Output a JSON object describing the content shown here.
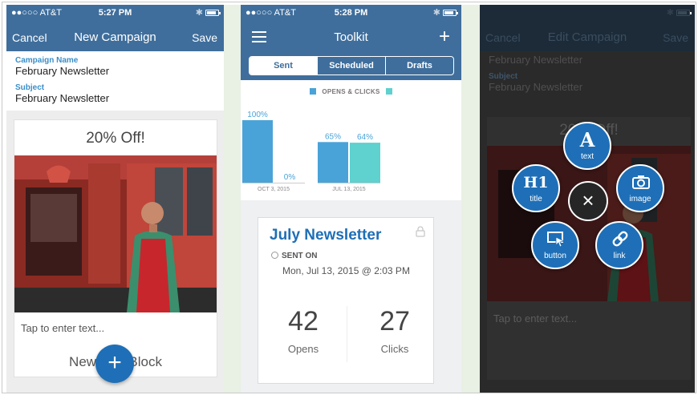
{
  "colors": {
    "nav_blue": "#3f6e9c",
    "accent_blue": "#1e6fb7",
    "field_label": "#3a8fc9",
    "bar_sent": "#4aa3d8",
    "bar_clicks": "#5fd1cf"
  },
  "screen1": {
    "status": {
      "carrier": "●●○○○ AT&T",
      "time": "5:27 PM"
    },
    "nav": {
      "left": "Cancel",
      "title": "New Campaign",
      "right": "Save"
    },
    "campaign_name_label": "Campaign Name",
    "campaign_name_value": "February Newsletter",
    "subject_label": "Subject",
    "subject_value": "February Newsletter",
    "promo_title": "20% Off!",
    "tap_placeholder": "Tap to enter text...",
    "new_block_label": "New Text Block",
    "fab_icon": "plus-icon",
    "fab_symbol": "+"
  },
  "screen2": {
    "status": {
      "carrier": "●●○○○ AT&T",
      "time": "5:28 PM"
    },
    "nav": {
      "title": "Toolkit",
      "right_symbol": "+"
    },
    "tabs": [
      "Sent",
      "Scheduled",
      "Drafts"
    ],
    "selected_tab": "Sent",
    "newsletter_title": "July Newsletter",
    "sent_on_label": "SENT ON",
    "sent_on_date": "Mon, Jul 13, 2015 @ 2:03 PM",
    "opens_value": "42",
    "opens_label": "Opens",
    "clicks_value": "27",
    "clicks_label": "Clicks"
  },
  "chart_data": {
    "type": "bar",
    "title": "",
    "legend": "OPENS & CLICKS",
    "categories": [
      "OCT 3, 2015",
      "JUL 13, 2015"
    ],
    "series": [
      {
        "values": [
          100,
          65
        ],
        "labels": [
          "100%",
          "65%"
        ]
      },
      {
        "values": [
          0,
          64
        ],
        "labels": [
          "0%",
          "64%"
        ]
      }
    ],
    "ylim": [
      0,
      100
    ],
    "xlabel": "",
    "ylabel": ""
  },
  "screen3": {
    "nav": {
      "left": "Cancel",
      "title": "Edit Campaign",
      "right": "Save"
    },
    "field_value_1": "February Newsletter",
    "subject_label": "Subject",
    "subject_value": "February Newsletter",
    "promo_title": "20% Off!",
    "tap_placeholder": "Tap to enter text...",
    "menu": [
      {
        "label": "text",
        "glyph": "A",
        "icon": "text-icon"
      },
      {
        "label": "title",
        "glyph": "H1",
        "icon": "title-icon"
      },
      {
        "label": "image",
        "icon": "camera-icon"
      },
      {
        "label": "button",
        "icon": "button-icon"
      },
      {
        "label": "link",
        "icon": "link-icon"
      }
    ],
    "close_symbol": "×"
  }
}
